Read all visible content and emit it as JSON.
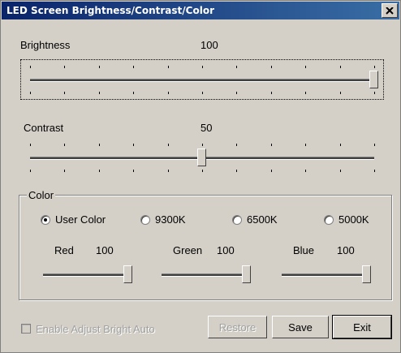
{
  "window": {
    "title": "LED Screen Brightness/Contrast/Color",
    "close_glyph": "×"
  },
  "brightness": {
    "label": "Brightness",
    "value": "100",
    "level": 100,
    "max": 100
  },
  "contrast": {
    "label": "Contrast",
    "value": "50",
    "level": 50,
    "max": 100
  },
  "color_group": {
    "title": "Color",
    "presets": [
      {
        "label": "User Color",
        "selected": true
      },
      {
        "label": "9300K",
        "selected": false
      },
      {
        "label": "6500K",
        "selected": false
      },
      {
        "label": "5000K",
        "selected": false
      }
    ],
    "channels": [
      {
        "label": "Red",
        "value": "100",
        "level": 100
      },
      {
        "label": "Green",
        "value": "100",
        "level": 100
      },
      {
        "label": "Blue",
        "value": "100",
        "level": 100
      }
    ]
  },
  "auto_adjust": {
    "label": "Enable Adjust Bright Auto",
    "checked": false,
    "enabled": false
  },
  "buttons": {
    "restore": "Restore",
    "save": "Save",
    "exit": "Exit"
  }
}
